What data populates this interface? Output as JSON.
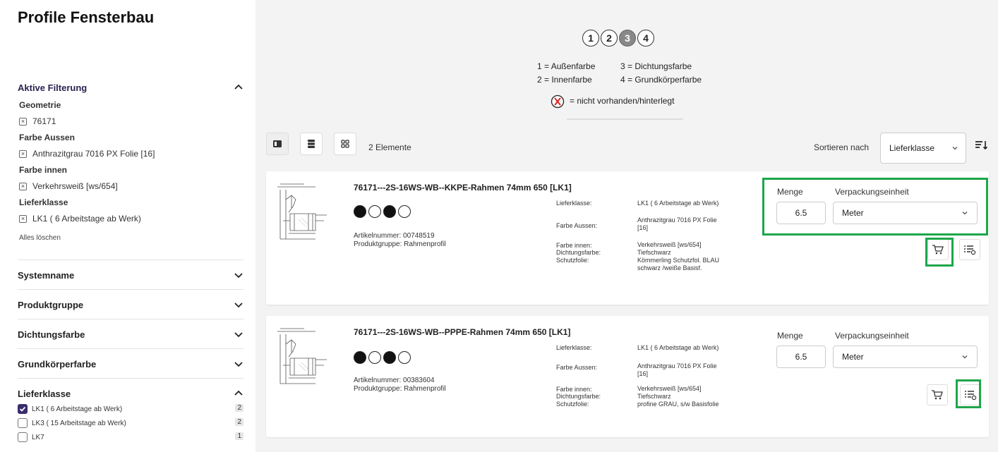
{
  "page": {
    "title": "Profile Fensterbau"
  },
  "legend": {
    "steps": [
      "1",
      "2",
      "3",
      "4"
    ],
    "active_step": "3",
    "line1a": "1 = Außenfarbe",
    "line1b": "3 = Dichtungsfarbe",
    "line2a": "2 = Innenfarbe",
    "line2b": "4 = Grundkörperfarbe",
    "line3": "= nicht vorhanden/hinterlegt"
  },
  "sidebar": {
    "active_filters_title": "Aktive Filterung",
    "groups": [
      {
        "title": "Geometrie",
        "chip": "76171"
      },
      {
        "title": "Farbe Aussen",
        "chip": "Anthrazitgrau 7016 PX Folie [16]"
      },
      {
        "title": "Farbe innen",
        "chip": "Verkehrsweiß [ws/654]"
      },
      {
        "title": "Lieferklasse",
        "chip": "LK1 ( 6 Arbeitstage ab Werk)"
      }
    ],
    "clear_all": "Alles löschen",
    "sections": [
      "Systemname",
      "Produktgruppe",
      "Dichtungsfarbe",
      "Grundkörperfarbe"
    ],
    "lieferklasse": {
      "title": "Lieferklasse",
      "options": [
        {
          "label": "LK1 ( 6 Arbeitstage ab Werk)",
          "count": "2",
          "checked": true
        },
        {
          "label": "LK3 ( 15 Arbeitstage ab Werk)",
          "count": "2",
          "checked": false
        },
        {
          "label": "LK7",
          "count": "1",
          "checked": false
        }
      ]
    }
  },
  "toolbar": {
    "elements_count": "2 Elemente",
    "sort_label": "Sortieren nach",
    "sort_value": "Lieferklasse"
  },
  "products": [
    {
      "title": "76171---2S-16WS-WB--KKPE-Rahmen 74mm 650 [LK1]",
      "article": "Artikelnummer: 00748519",
      "group": "Produktgruppe: Rahmenprofil",
      "attr_labels": [
        "Lieferklasse:",
        "Farbe Aussen:",
        "Farbe innen:",
        "Dichtungsfarbe:",
        "Schutzfolie:"
      ],
      "attr_values": [
        "LK1 ( 6 Arbeitstage ab Werk)",
        "Anthrazitgrau 7016 PX Folie [16]",
        "Verkehrsweiß [ws/654]",
        "Tiefschwarz",
        "Kömmerling Schutzfol. BLAU schwarz /weiße Basisf."
      ],
      "qty_label": "Menge",
      "qty": "6.5",
      "unit_label": "Verpackungseinheit",
      "unit": "Meter"
    },
    {
      "title": "76171---2S-16WS-WB--PPPE-Rahmen 74mm 650 [LK1]",
      "article": "Artikelnummer: 00383604",
      "group": "Produktgruppe: Rahmenprofil",
      "attr_labels": [
        "Lieferklasse:",
        "Farbe Aussen:",
        "Farbe innen:",
        "Dichtungsfarbe:",
        "Schutzfolie:"
      ],
      "attr_values": [
        "LK1 ( 6 Arbeitstage ab Werk)",
        "Anthrazitgrau 7016 PX Folie [16]",
        "Verkehrsweiß [ws/654]",
        "Tiefschwarz",
        "profine GRAU, s/w Basisfolie"
      ],
      "qty_label": "Menge",
      "qty": "6.5",
      "unit_label": "Verpackungseinheit",
      "unit": "Meter"
    }
  ],
  "colors": {
    "highlight": "#1ea64a",
    "accent": "#3a2d6e"
  }
}
